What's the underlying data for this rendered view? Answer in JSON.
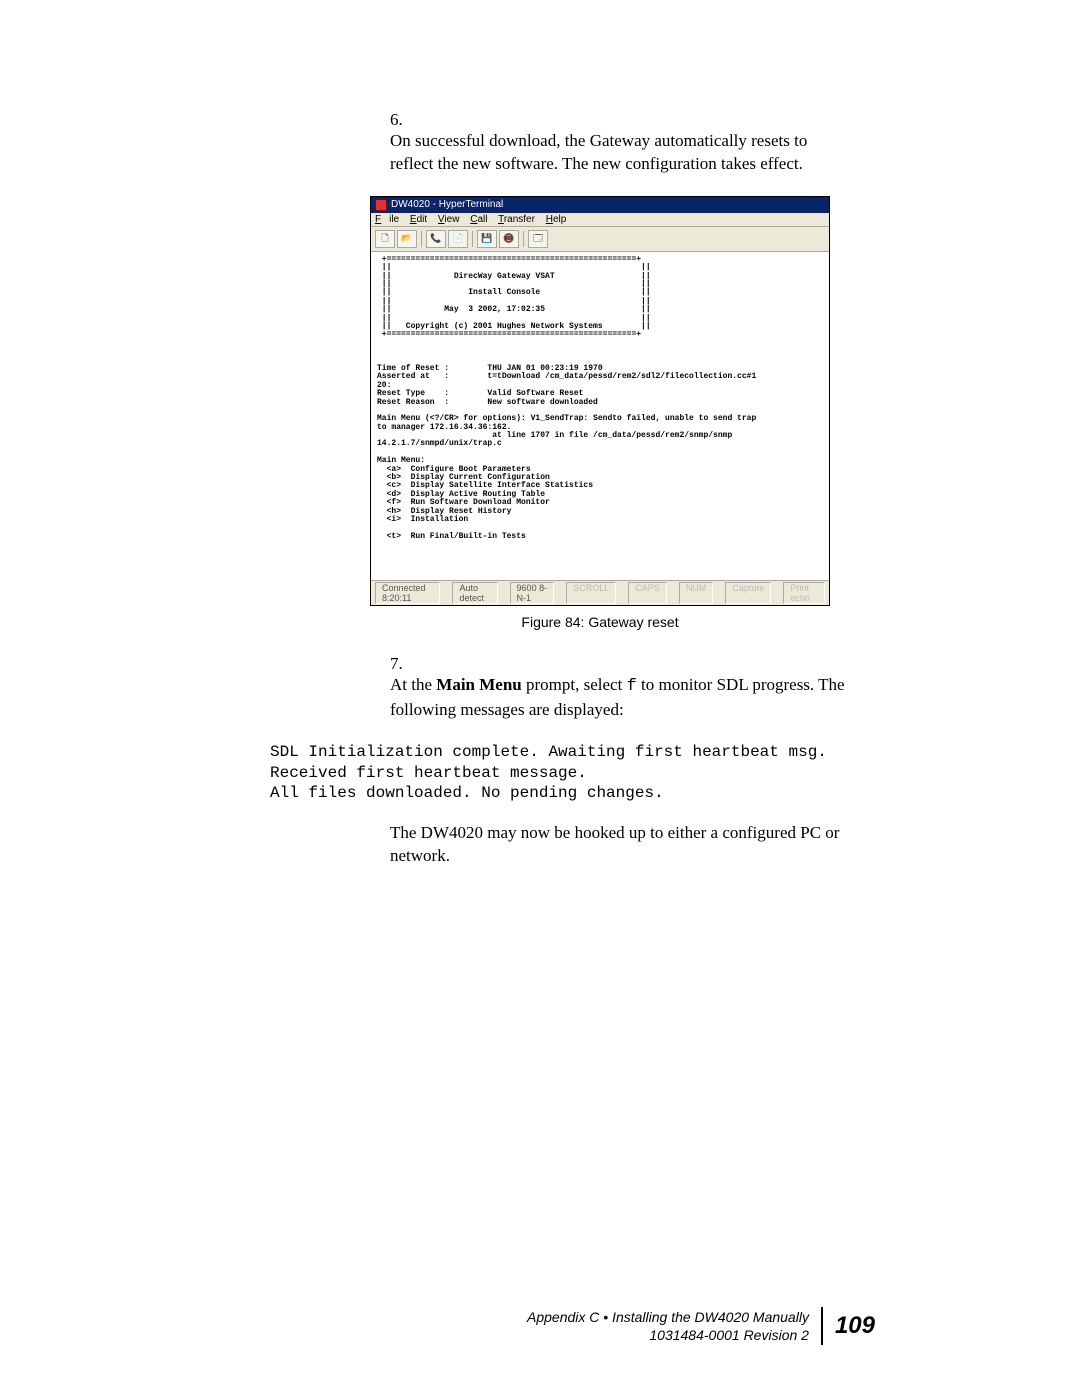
{
  "steps": {
    "s6": {
      "num": "6.",
      "text": "On successful download, the Gateway automatically resets to reflect the new software. The new configuration takes effect."
    },
    "s7": {
      "num": "7.",
      "prefix": "At the ",
      "bold": "Main Menu",
      "mid": " prompt, select ",
      "code": "f",
      "suffix": " to monitor SDL progress. The following messages are displayed:"
    }
  },
  "hyperterminal": {
    "title": "DW4020 - HyperTerminal",
    "menu": {
      "file": "File",
      "edit": "Edit",
      "view": "View",
      "call": "Call",
      "transfer": "Transfer",
      "help": "Help"
    },
    "toolbar": {
      "new": "🗋",
      "open": "📂",
      "save": "💾",
      "print": "📄",
      "connect": "📞",
      "disconnect": "📵",
      "props": "🗔"
    },
    "terminal": " +====================================================+\n ||                                                    ||\n ||             DirecWay Gateway VSAT                  ||\n ||                                                    ||\n ||                Install Console                     ||\n ||                                                    ||\n ||           May  3 2002, 17:02:35                    ||\n ||                                                    ||\n ||   Copyright (c) 2001 Hughes Network Systems        ||\n +====================================================+\n\n\n\nTime of Reset :        THU JAN 01 00:23:19 1970\nAsserted at   :        t=tDownload /cm_data/pessd/rem2/sdl2/filecollection.cc#1\n20:\nReset Type    :        Valid Software Reset\nReset Reason  :        New software downloaded\n\nMain Menu (<?/CR> for options): V1_SendTrap: Sendto failed, unable to send trap\nto manager 172.16.34.36:162.\n                        at line 1707 in file /cm_data/pessd/rem2/snmp/snmp\n14.2.1.7/snmpd/unix/trap.c\n\nMain Menu:\n  <a>  Configure Boot Parameters\n  <b>  Display Current Configuration\n  <c>  Display Satellite Interface Statistics\n  <d>  Display Active Routing Table\n  <f>  Run Software Download Monitor\n  <h>  Display Reset History\n  <i>  Installation\n\n  <t>  Run Final/Built-in Tests",
    "status": {
      "connected": "Connected 8:20:11",
      "detect": "Auto detect",
      "baud": "9600 8-N-1",
      "scroll": "SCROLL",
      "caps": "CAPS",
      "num": "NUM",
      "capture": "Capture",
      "printecho": "Print echo"
    }
  },
  "figure_caption": "Figure 84:  Gateway reset",
  "code_block": "SDL Initialization complete. Awaiting first heartbeat msg.\nReceived first heartbeat message.\nAll files downloaded. No pending changes.",
  "followup_text": "The DW4020 may now be hooked up to either a configured PC or network.",
  "footer": {
    "line1": "Appendix C • Installing the DW4020 Manually",
    "line2": "1031484-0001  Revision 2",
    "page": "109"
  }
}
